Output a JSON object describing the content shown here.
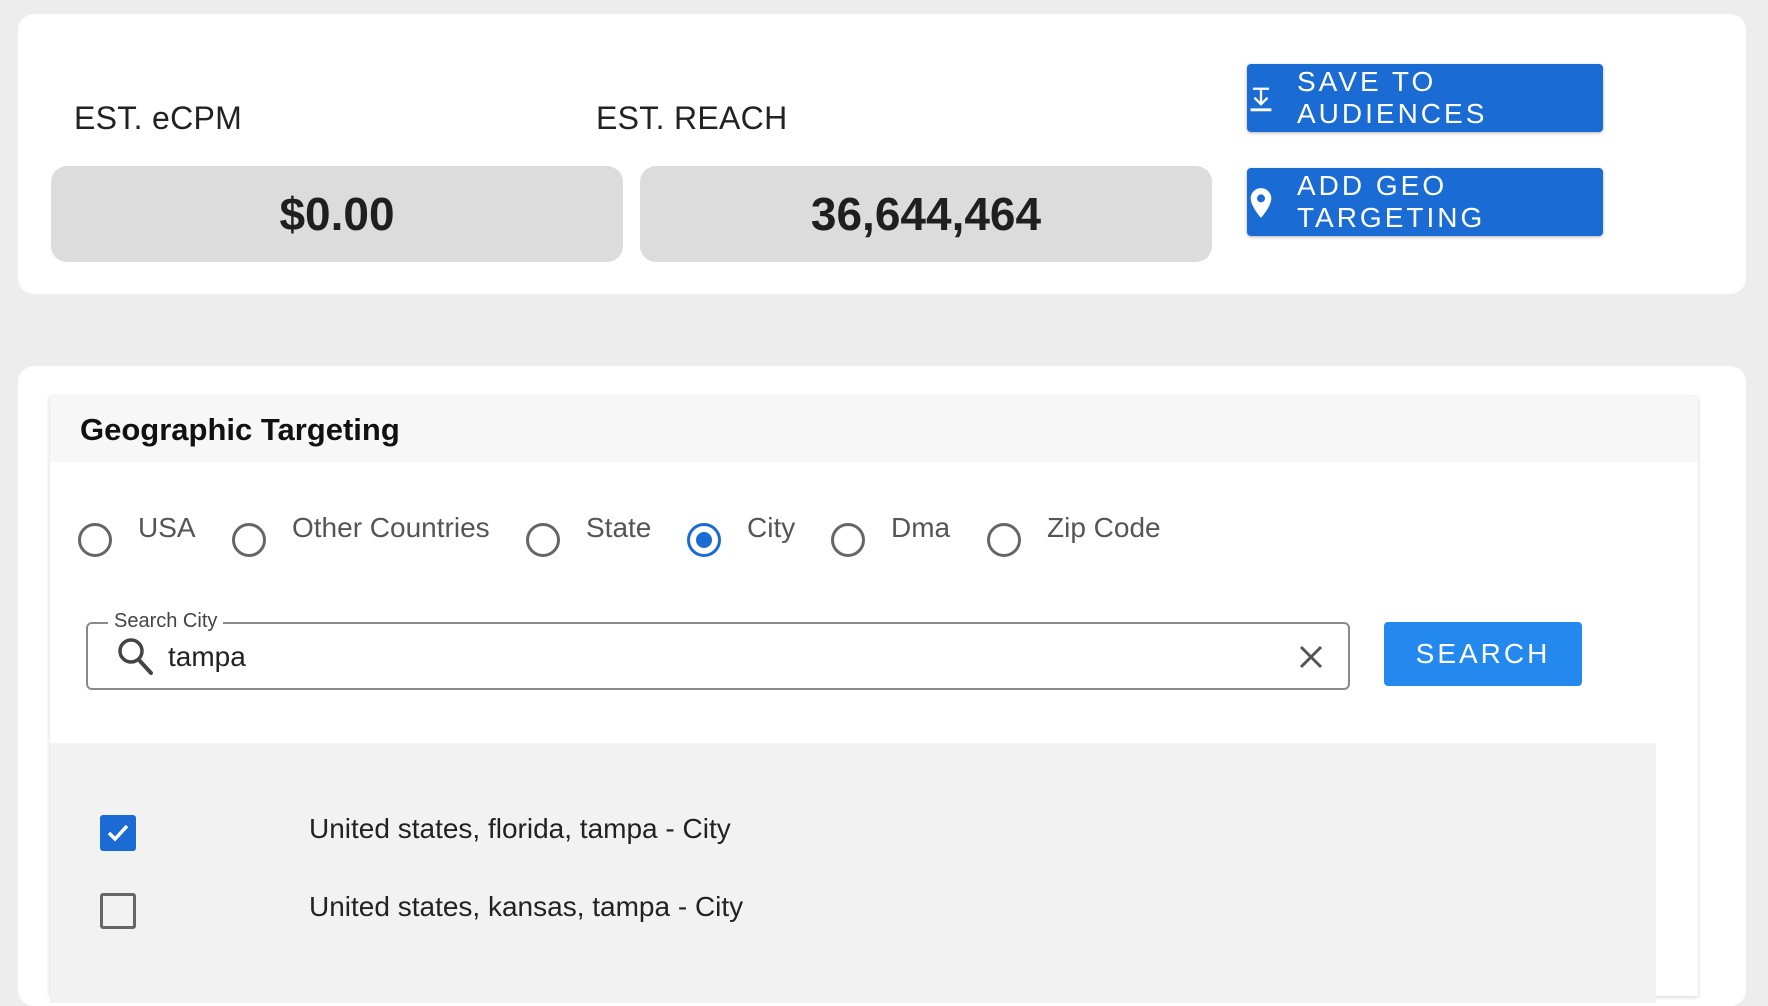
{
  "estimates": {
    "ecpm_label": "EST. eCPM",
    "ecpm_value": "$0.00",
    "reach_label": "EST. REACH",
    "reach_value": "36,644,464"
  },
  "actions": {
    "save_label": "SAVE TO AUDIENCES",
    "save_icon": "download-icon",
    "geo_label": "ADD GEO TARGETING",
    "geo_icon": "location-pin-icon"
  },
  "geo": {
    "title": "Geographic Targeting",
    "options": [
      {
        "label": "USA",
        "checked": false
      },
      {
        "label": "Other Countries",
        "checked": false
      },
      {
        "label": "State",
        "checked": false
      },
      {
        "label": "City",
        "checked": true
      },
      {
        "label": "Dma",
        "checked": false
      },
      {
        "label": "Zip Code",
        "checked": false
      }
    ],
    "search": {
      "label": "Search City",
      "value": "tampa",
      "button_label": "SEARCH"
    },
    "results": [
      {
        "label": "United states, florida, tampa - City",
        "checked": true
      },
      {
        "label": "United states, kansas, tampa - City",
        "checked": false
      }
    ]
  },
  "colors": {
    "accent": "#1a6cd4",
    "search_button": "#2389ee",
    "background": "#ededed"
  }
}
